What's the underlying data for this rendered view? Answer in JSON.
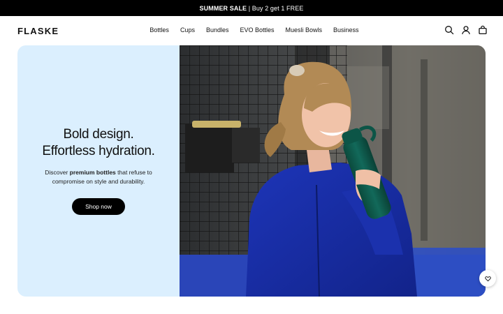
{
  "promo": {
    "highlight": "SUMMER SALE",
    "rest": " | Buy 2 get 1 FREE"
  },
  "brand": {
    "logo": "FLASKE"
  },
  "nav": [
    "Bottles",
    "Cups",
    "Bundles",
    "EVO Bottles",
    "Muesli Bowls",
    "Business"
  ],
  "icons": {
    "search": "search-icon",
    "account": "user-icon",
    "cart": "bag-icon",
    "wishlist": "heart-icon"
  },
  "hero": {
    "title_line1": "Bold design.",
    "title_line2": "Effortless hydration.",
    "sub_before": "Discover ",
    "sub_bold": "premium bottles",
    "sub_after": " that refuse to",
    "sub_line2": "compromise on style and durability.",
    "cta": "Shop now",
    "image_description": "Smiling woman in a blue jacket drinking from a dark green bottle beside a padel court fence"
  },
  "colors": {
    "promo_bg": "#000000",
    "hero_panel": "#dbeffe",
    "cta_bg": "#000000",
    "jacket": "#1a2fa3",
    "bottle": "#0f5a4a"
  }
}
